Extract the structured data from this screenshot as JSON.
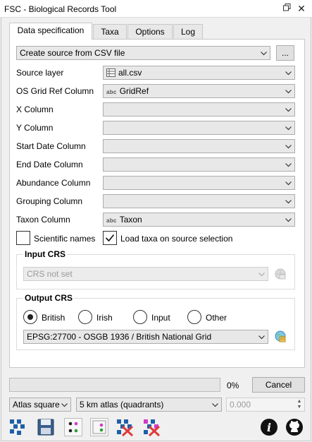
{
  "window": {
    "title": "FSC - Biological Records Tool"
  },
  "tabs": [
    {
      "label": "Data specification"
    },
    {
      "label": "Taxa"
    },
    {
      "label": "Options"
    },
    {
      "label": "Log"
    }
  ],
  "source": {
    "selected": "Create source from CSV file",
    "browse_label": "..."
  },
  "fields": {
    "source_layer": {
      "label": "Source layer",
      "value": "all.csv"
    },
    "os_grid_ref": {
      "label": "OS Grid Ref Column",
      "value": "GridRef",
      "type_tag": "abc"
    },
    "x_column": {
      "label": "X Column",
      "value": ""
    },
    "y_column": {
      "label": "Y Column",
      "value": ""
    },
    "start_date": {
      "label": "Start Date Column",
      "value": ""
    },
    "end_date": {
      "label": "End Date Column",
      "value": ""
    },
    "abundance": {
      "label": "Abundance Column",
      "value": ""
    },
    "grouping": {
      "label": "Grouping Column",
      "value": ""
    },
    "taxon": {
      "label": "Taxon Column",
      "value": "Taxon",
      "type_tag": "abc"
    }
  },
  "checks": {
    "scientific_names": {
      "label": "Scientific names",
      "checked": false
    },
    "load_taxa": {
      "label": "Load taxa on source selection",
      "checked": true
    }
  },
  "input_crs": {
    "title": "Input CRS",
    "value": "CRS not set"
  },
  "output_crs": {
    "title": "Output CRS",
    "options": [
      "British",
      "Irish",
      "Input",
      "Other"
    ],
    "selected": "British",
    "value": "EPSG:27700 - OSGB 1936 / British National Grid"
  },
  "progress": {
    "percent_text": "0%",
    "cancel_label": "Cancel",
    "value": 0
  },
  "bottom": {
    "atlas_type": "Atlas square",
    "atlas_size": "5 km atlas (quadrants)",
    "value": "0.000"
  },
  "toolbar_icons": [
    "map-grid-icon",
    "save-icon",
    "dot-legend-icon",
    "legend-frame-icon",
    "clear-map-icon",
    "clear-all-icon",
    "info-icon",
    "github-icon"
  ],
  "colors": {
    "accent_blue": "#1f5fa8",
    "accent_red": "#e03a3a",
    "accent_magenta": "#d23ac8"
  }
}
